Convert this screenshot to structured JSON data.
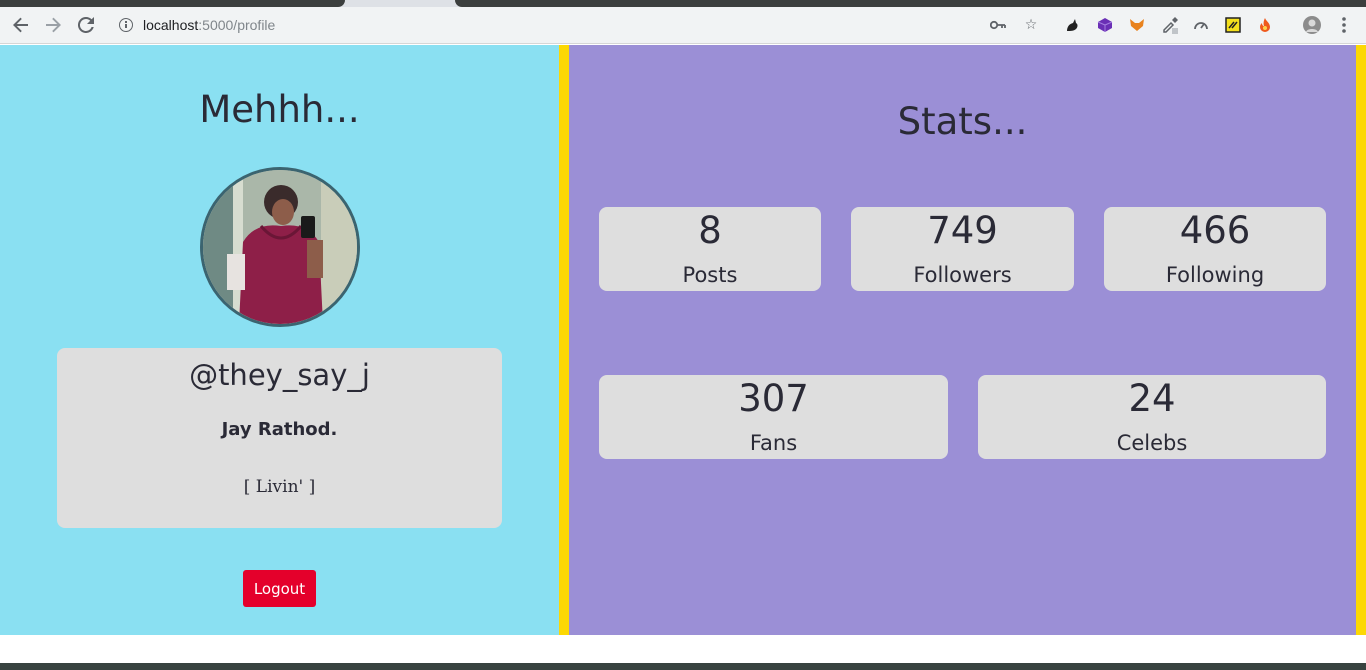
{
  "browser": {
    "url_host": "localhost",
    "url_path": ":5000/profile",
    "extensions": [
      "key-icon",
      "star-icon",
      "gnome-icon",
      "cube-icon",
      "fox-icon",
      "eyedropper-icon",
      "speed-icon",
      "pen-icon",
      "fire-icon",
      "avatar-icon",
      "menu-icon"
    ]
  },
  "profile": {
    "heading": "Mehhh...",
    "handle": "@they_say_j",
    "name": "Jay Rathod.",
    "bio": "[ Livin' ]",
    "logout_label": "Logout"
  },
  "stats": {
    "heading": "Stats...",
    "items": [
      {
        "value": "8",
        "label": "Posts"
      },
      {
        "value": "749",
        "label": "Followers"
      },
      {
        "value": "466",
        "label": "Following"
      },
      {
        "value": "307",
        "label": "Fans"
      },
      {
        "value": "24",
        "label": "Celebs"
      }
    ]
  },
  "colors": {
    "left_bg": "#8ae0f2",
    "right_bg": "#9b8fd6",
    "divider": "#fcd804",
    "card": "#dedede",
    "logout": "#e4002b"
  }
}
